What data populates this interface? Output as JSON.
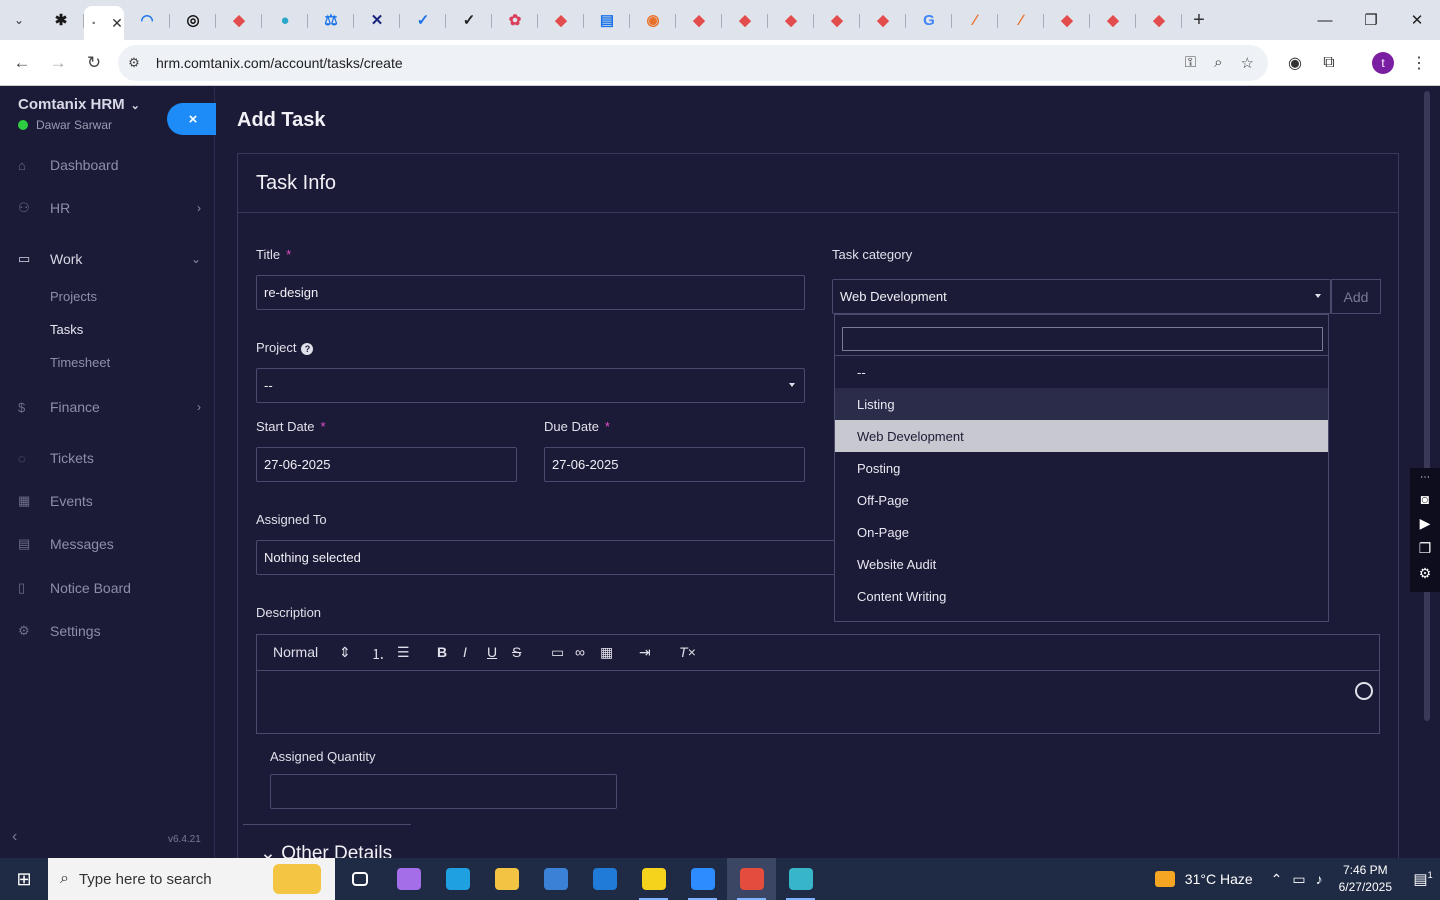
{
  "browser": {
    "url": "hrm.comtanix.com/account/tasks/create",
    "profile_initial": "t",
    "tabs": [
      {
        "icon": "tab-icon-1",
        "color": "#1a1a1a",
        "glyph": "✱"
      },
      {
        "icon": "tab-icon-active",
        "color": "#777777",
        "glyph": "·"
      },
      {
        "icon": "tab-icon-2",
        "color": "#1a73e8",
        "glyph": "◠"
      },
      {
        "icon": "tab-icon-3",
        "color": "#111111",
        "glyph": "◎"
      },
      {
        "icon": "tab-icon-4",
        "color": "#e34c4c",
        "glyph": "◆"
      },
      {
        "icon": "tab-icon-5",
        "color": "#2aa7c9",
        "glyph": "●"
      },
      {
        "icon": "tab-icon-6",
        "color": "#1a73e8",
        "glyph": "⚖"
      },
      {
        "icon": "tab-icon-7",
        "color": "#1a237e",
        "glyph": "✕"
      },
      {
        "icon": "tab-icon-8",
        "color": "#1a73e8",
        "glyph": "✓"
      },
      {
        "icon": "tab-icon-9",
        "color": "#222222",
        "glyph": "✓"
      },
      {
        "icon": "tab-icon-10",
        "color": "#d93f5a",
        "glyph": "✿"
      },
      {
        "icon": "tab-icon-11",
        "color": "#e34c4c",
        "glyph": "◆"
      },
      {
        "icon": "tab-icon-12",
        "color": "#1a73e8",
        "glyph": "▤"
      },
      {
        "icon": "tab-icon-13",
        "color": "#e8712a",
        "glyph": "◉"
      },
      {
        "icon": "tab-icon-14",
        "color": "#e34c4c",
        "glyph": "◆"
      },
      {
        "icon": "tab-icon-15",
        "color": "#e34c4c",
        "glyph": "◆"
      },
      {
        "icon": "tab-icon-16",
        "color": "#e34c4c",
        "glyph": "◆"
      },
      {
        "icon": "tab-icon-17",
        "color": "#e34c4c",
        "glyph": "◆"
      },
      {
        "icon": "tab-icon-18",
        "color": "#e34c4c",
        "glyph": "◆"
      },
      {
        "icon": "tab-icon-19",
        "color": "#4285f4",
        "glyph": "G"
      },
      {
        "icon": "tab-icon-20",
        "color": "#e8712a",
        "glyph": "∕"
      },
      {
        "icon": "tab-icon-21",
        "color": "#e8712a",
        "glyph": "∕"
      },
      {
        "icon": "tab-icon-22",
        "color": "#e34c4c",
        "glyph": "◆"
      },
      {
        "icon": "tab-icon-23",
        "color": "#e34c4c",
        "glyph": "◆"
      },
      {
        "icon": "tab-icon-24",
        "color": "#e34c4c",
        "glyph": "◆"
      }
    ]
  },
  "sidebar": {
    "brand": "Comtanix HRM",
    "user": "Dawar Sarwar",
    "collapse_label": "×",
    "items": [
      {
        "label": "Dashboard",
        "icon": "home-icon",
        "glyph": "⌂"
      },
      {
        "label": "HR",
        "icon": "people-icon",
        "glyph": "⚇"
      },
      {
        "label": "Work",
        "icon": "briefcase-icon",
        "glyph": "▭"
      },
      {
        "label": "Finance",
        "icon": "dollar-icon",
        "glyph": "$"
      },
      {
        "label": "Tickets",
        "icon": "ticket-icon",
        "glyph": "◌"
      },
      {
        "label": "Events",
        "icon": "calendar-icon",
        "glyph": "▦"
      },
      {
        "label": "Messages",
        "icon": "message-icon",
        "glyph": "▤"
      },
      {
        "label": "Notice Board",
        "icon": "notice-icon",
        "glyph": "▯"
      },
      {
        "label": "Settings",
        "icon": "gear-icon",
        "glyph": "⚙"
      }
    ],
    "work_sub": [
      "Projects",
      "Tasks",
      "Timesheet"
    ],
    "version": "v6.4.21"
  },
  "page": {
    "title": "Add Task",
    "card_title": "Task Info",
    "title_label": "Title",
    "title_value": "re-design",
    "category_label": "Task category",
    "category_value": "Web Development",
    "add_label": "Add",
    "project_label": "Project",
    "project_value": "--",
    "start_label": "Start Date",
    "start_value": "27-06-2025",
    "due_label": "Due Date",
    "due_value": "27-06-2025",
    "assigned_label": "Assigned To",
    "assigned_value": "Nothing selected",
    "description_label": "Description",
    "editor_format": "Normal",
    "quantity_label": "Assigned Quantity",
    "other_details": "Other Details"
  },
  "dropdown": {
    "options": [
      "--",
      "Listing",
      "Web Development",
      "Posting",
      "Off-Page",
      "On-Page",
      "Website Audit",
      "Content Writing"
    ],
    "hover_index": 1,
    "selected_index": 2
  },
  "taskbar": {
    "search_placeholder": "Type here to search",
    "weather": "31°C  Haze",
    "time": "7:46 PM",
    "date": "6/27/2025",
    "notif_count": "1",
    "apps": [
      {
        "name": "task-view",
        "color": "#ffffff",
        "run": false,
        "focus": false
      },
      {
        "name": "copilot",
        "color": "#a46ee8",
        "run": false,
        "focus": false
      },
      {
        "name": "edge",
        "color": "#1fa0e0",
        "run": false,
        "focus": false
      },
      {
        "name": "file-explorer",
        "color": "#f3c343",
        "run": false,
        "focus": false
      },
      {
        "name": "store",
        "color": "#3b82d6",
        "run": false,
        "focus": false
      },
      {
        "name": "mail",
        "color": "#1f7ad8",
        "run": false,
        "focus": false
      },
      {
        "name": "sticky-notes",
        "color": "#f5d21c",
        "run": true,
        "focus": false
      },
      {
        "name": "zoom",
        "color": "#2d8cff",
        "run": true,
        "focus": false
      },
      {
        "name": "chrome",
        "color": "#e44c3d",
        "run": true,
        "focus": true
      },
      {
        "name": "app-diamond",
        "color": "#38b6c9",
        "run": true,
        "focus": false
      }
    ]
  }
}
